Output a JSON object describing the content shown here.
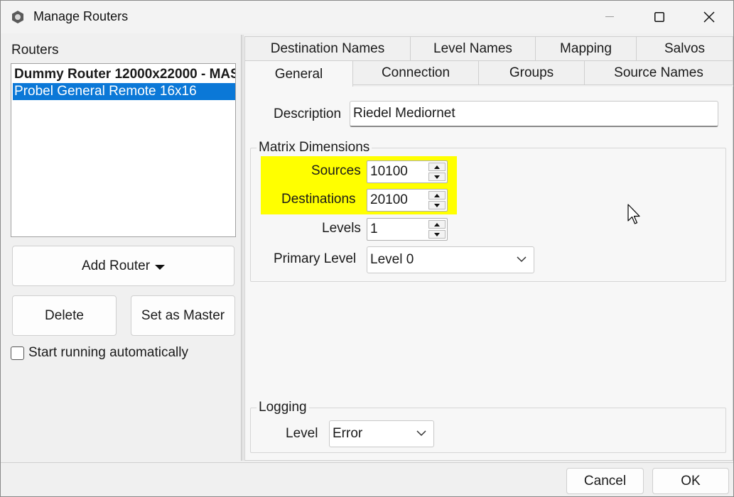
{
  "window": {
    "title": "Manage Routers"
  },
  "left": {
    "routers_label": "Routers",
    "routers": [
      {
        "label": "Dummy Router 12000x22000 - MAS",
        "bold": true
      },
      {
        "label": "Probel General Remote 16x16",
        "selected": true
      }
    ],
    "add_router_label": "Add Router",
    "delete_label": "Delete",
    "set_master_label": "Set as Master",
    "auto_start_label": "Start running automatically",
    "auto_start_checked": false
  },
  "tabs": {
    "row1": [
      "Destination Names",
      "Level Names",
      "Mapping",
      "Salvos"
    ],
    "row2": [
      "General",
      "Connection",
      "Groups",
      "Source Names"
    ],
    "active": "General"
  },
  "general": {
    "description_label": "Description",
    "description_value": "Riedel Mediornet",
    "matrix_group_title": "Matrix Dimensions",
    "sources_label": "Sources",
    "sources_value": "10100",
    "destinations_label": "Destinations",
    "destinations_value": "20100",
    "levels_label": "Levels",
    "levels_value": "1",
    "primary_level_label": "Primary Level",
    "primary_level_value": "Level 0",
    "highlight_color": "#ffff00",
    "logging_group_title": "Logging",
    "log_level_label": "Level",
    "log_level_value": "Error"
  },
  "footer": {
    "cancel_label": "Cancel",
    "ok_label": "OK"
  },
  "colors": {
    "selection": "#0b78d7",
    "highlight": "#ffff00"
  }
}
